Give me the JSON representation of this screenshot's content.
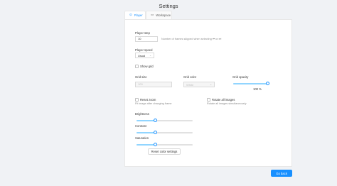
{
  "page": {
    "title": "Settings"
  },
  "tabs": [
    {
      "label": "Player",
      "icon": "play-circle-icon",
      "active": true
    },
    {
      "label": "Workspace",
      "icon": "laptop-icon",
      "active": false
    }
  ],
  "player": {
    "player_step": {
      "label": "Player step",
      "value": "10",
      "hint": "Number of frames skipped when selecting ⏮ or ⏭"
    },
    "player_speed": {
      "label": "Player speed",
      "value": "Usual"
    },
    "show_grid": {
      "label": "Show grid",
      "checked": false
    },
    "grid_size": {
      "label": "Grid size",
      "value": "100"
    },
    "grid_color": {
      "label": "Grid color",
      "value": "White"
    },
    "grid_opacity": {
      "label": "Grid opacity",
      "value_text": "100 %",
      "value": 1.0
    },
    "reset_zoom": {
      "label": "Reset zoom",
      "hint": "Fit image after changing frame",
      "checked": false
    },
    "rotate_all": {
      "label": "Rotate all images",
      "hint": "Rotate all images simultaneously",
      "checked": false
    },
    "brightness": {
      "label": "Brightness",
      "value": 0.33
    },
    "contrast": {
      "label": "Contrast",
      "value": 0.33
    },
    "saturation": {
      "label": "Saturation",
      "value": 0.33
    },
    "reset_color_label": "Reset color settings"
  },
  "footer": {
    "go_back_label": "Go back"
  },
  "colors": {
    "accent": "#1890ff",
    "background": "#f0f2f5",
    "panel": "#ffffff"
  }
}
